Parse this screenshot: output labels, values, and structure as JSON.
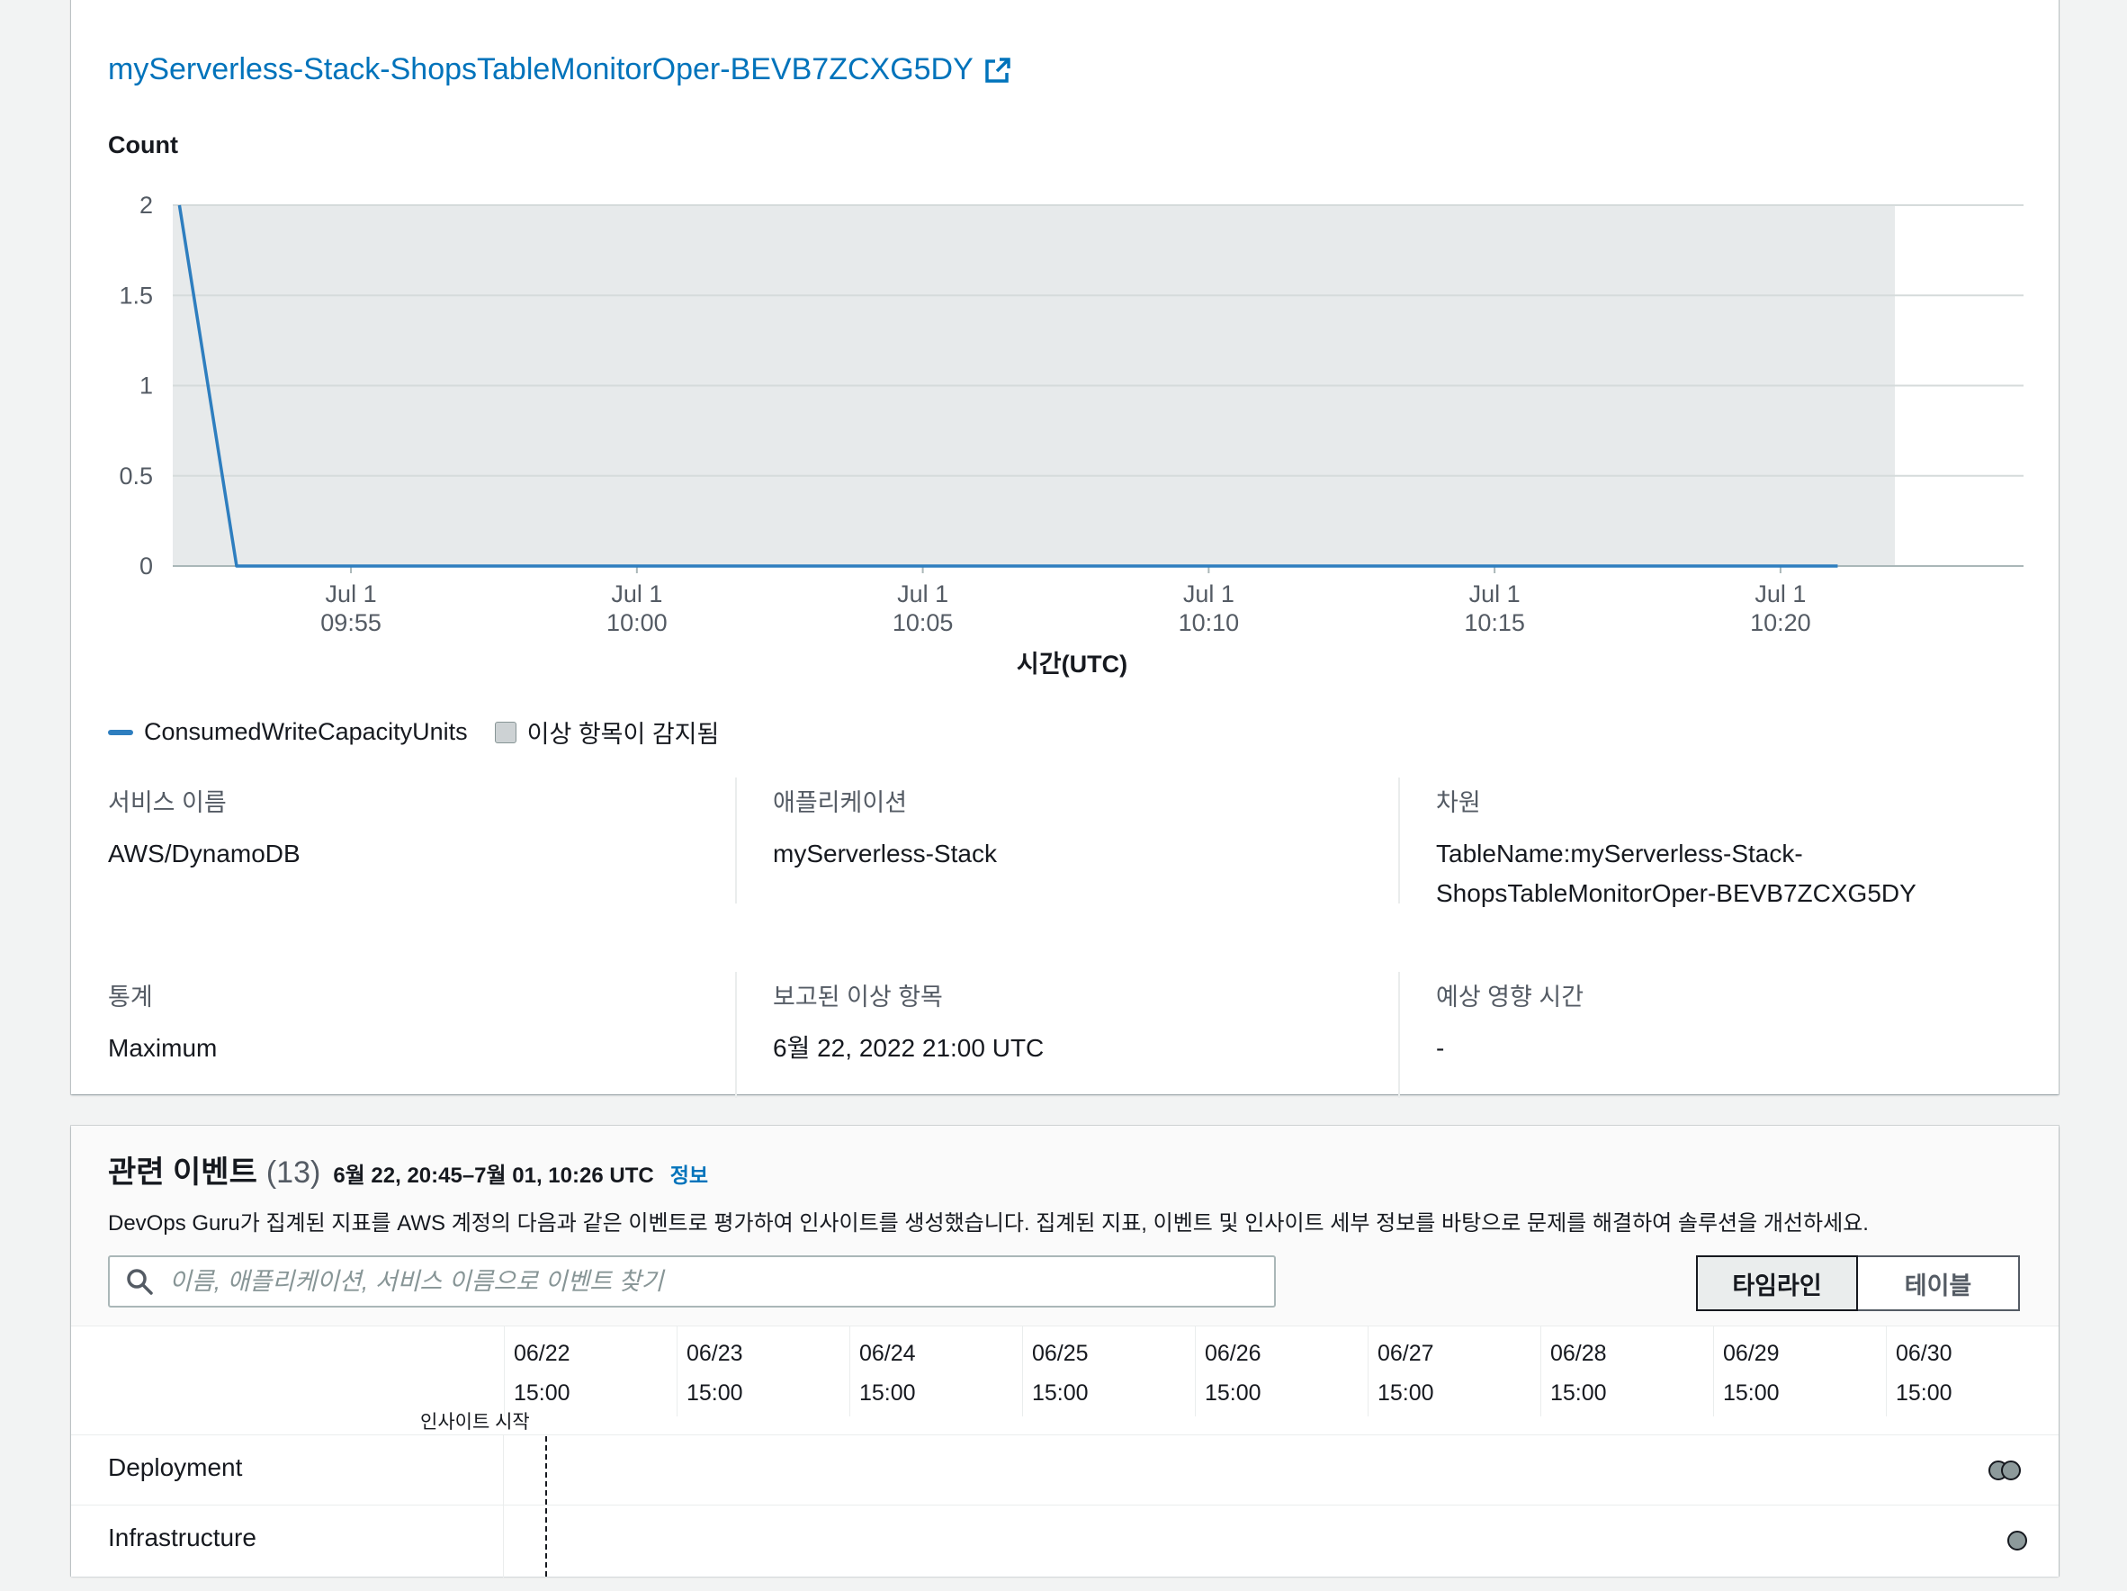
{
  "metric_panel": {
    "title": "myServerless-Stack-ShopsTableMonitorOper-BEVB7ZCXG5DY",
    "external_link_icon": "external-link-icon",
    "legend": {
      "series_label": "ConsumedWriteCapacityUnits",
      "anomaly_label": "이상 항목이 감지됨"
    },
    "details": {
      "service_name_label": "서비스 이름",
      "service_name_value": "AWS/DynamoDB",
      "application_label": "애플리케이션",
      "application_value": "myServerless-Stack",
      "dimension_label": "차원",
      "dimension_value_line1": "TableName:myServerless-Stack-",
      "dimension_value_line2": "ShopsTableMonitorOper-BEVB7ZCXG5DY",
      "statistic_label": "통계",
      "statistic_value": "Maximum",
      "reported_anomaly_label": "보고된 이상 항목",
      "reported_anomaly_value": "6월 22, 2022 21:00 UTC",
      "expected_impact_label": "예상 영향 시간",
      "expected_impact_value": "-"
    }
  },
  "chart_data": {
    "type": "line",
    "ylabel": "Count",
    "xlabel": "시간(UTC)",
    "ylim": [
      0,
      2
    ],
    "yticks": [
      "0",
      "0.5",
      "1",
      "1.5",
      "2"
    ],
    "xticks": [
      {
        "date": "Jul 1",
        "time": "09:55"
      },
      {
        "date": "Jul 1",
        "time": "10:00"
      },
      {
        "date": "Jul 1",
        "time": "10:05"
      },
      {
        "date": "Jul 1",
        "time": "10:10"
      },
      {
        "date": "Jul 1",
        "time": "10:15"
      },
      {
        "date": "Jul 1",
        "time": "10:20"
      }
    ],
    "xlim": [
      "09:51:53",
      "10:24:15"
    ],
    "anomaly_region": [
      "09:51:53",
      "10:22:00"
    ],
    "series": [
      {
        "name": "ConsumedWriteCapacityUnits",
        "color": "#2e7ebf",
        "x": [
          "09:52",
          "09:53",
          "10:21"
        ],
        "values": [
          2,
          0,
          0
        ]
      }
    ],
    "grid": true
  },
  "events_panel": {
    "title": "관련 이벤트",
    "count": "(13)",
    "range": "6월 22, 20:45–7월 01, 10:26 UTC",
    "info_link": "정보",
    "description": "DevOps Guru가 집계된 지표를 AWS 계정의 다음과 같은 이벤트로 평가하여 인사이트를 생성했습니다. 집계된 지표, 이벤트 및 인사이트 세부 정보를 바탕으로 문제를 해결하여 솔루션을 개선하세요.",
    "search_placeholder": "이름, 애플리케이션, 서비스 이름으로 이벤트 찾기",
    "search_icon": "search-icon",
    "view_timeline": "타임라인",
    "view_table": "테이블",
    "timeline_dates": [
      {
        "date": "06/22",
        "time": "15:00"
      },
      {
        "date": "06/23",
        "time": "15:00"
      },
      {
        "date": "06/24",
        "time": "15:00"
      },
      {
        "date": "06/25",
        "time": "15:00"
      },
      {
        "date": "06/26",
        "time": "15:00"
      },
      {
        "date": "06/27",
        "time": "15:00"
      },
      {
        "date": "06/28",
        "time": "15:00"
      },
      {
        "date": "06/29",
        "time": "15:00"
      },
      {
        "date": "06/30",
        "time": "15:00"
      }
    ],
    "insight_start_label": "인사이트 시작",
    "rows": [
      {
        "label": "Deployment"
      },
      {
        "label": "Infrastructure"
      }
    ],
    "event_color": "#8d9a9b"
  }
}
